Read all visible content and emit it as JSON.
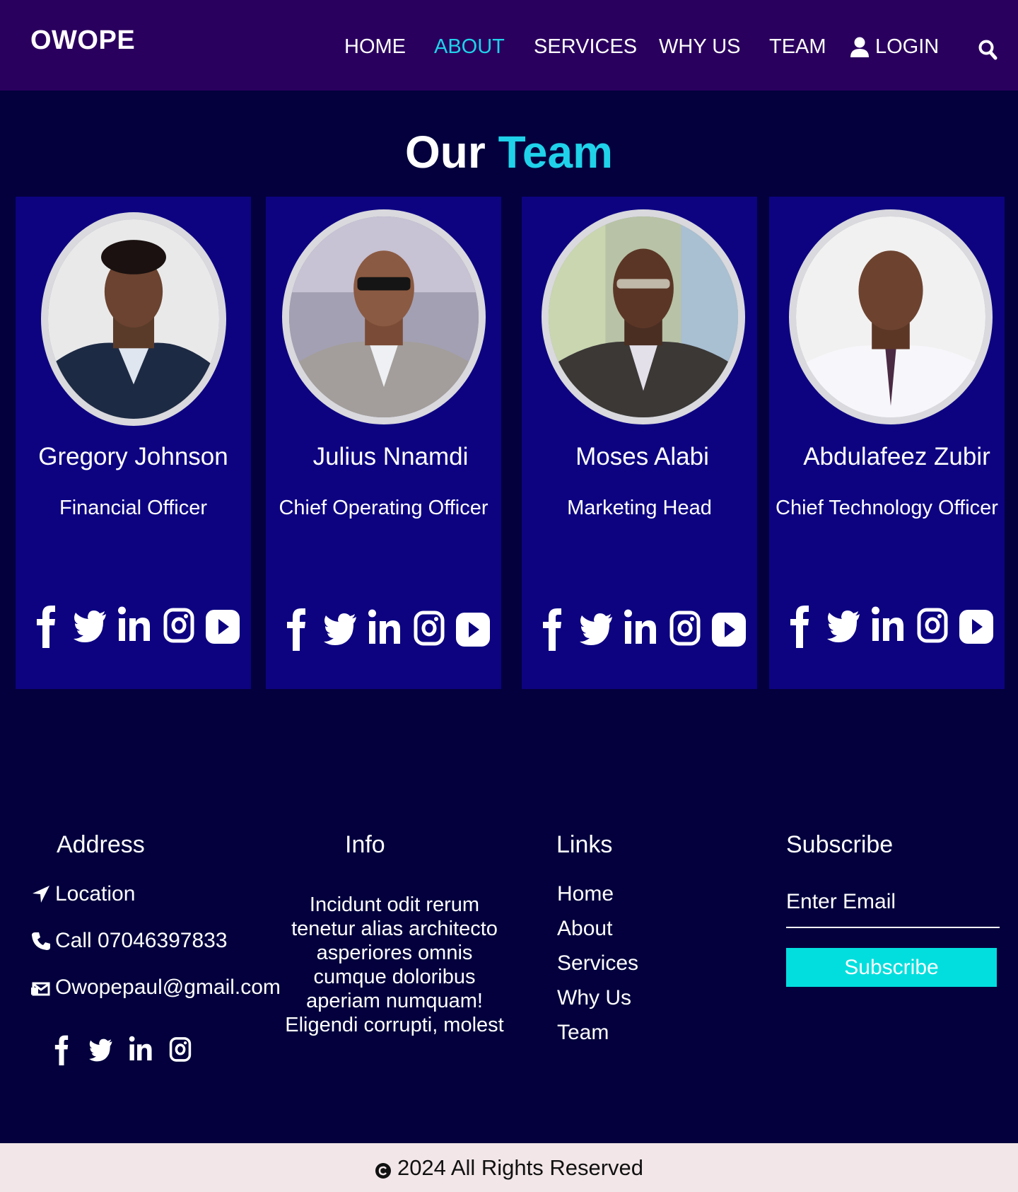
{
  "brand": {
    "logo": "OWOPE"
  },
  "nav": {
    "items": [
      {
        "label": "HOME",
        "active": false
      },
      {
        "label": "ABOUT",
        "active": true
      },
      {
        "label": "SERVICES",
        "active": false
      },
      {
        "label": "WHY US",
        "active": false
      },
      {
        "label": "TEAM",
        "active": false
      }
    ],
    "login_label": "LOGIN",
    "accent_color": "#1fd2ea"
  },
  "team_section": {
    "title_prefix": "Our",
    "title_accent": "Team",
    "members": [
      {
        "name": "Gregory Johnson",
        "role": "Financial Officer"
      },
      {
        "name": "Julius Nnamdi",
        "role": "Chief Operating Officer"
      },
      {
        "name": "Moses Alabi",
        "role": "Marketing Head"
      },
      {
        "name": "Abdulafeez Zubir",
        "role": "Chief Technology Officer"
      }
    ],
    "social_icons": [
      "facebook-icon",
      "twitter-icon",
      "linkedin-icon",
      "instagram-icon",
      "youtube-icon"
    ]
  },
  "footer": {
    "address": {
      "title": "Address",
      "location": "Location",
      "phone": "Call 07046397833",
      "email": "Owopepaul@gmail.com",
      "social_icons": [
        "facebook-icon",
        "twitter-icon",
        "linkedin-icon",
        "instagram-icon"
      ]
    },
    "info": {
      "title": "Info",
      "text": "Incidunt odit rerum tenetur alias architecto asperiores omnis cumque doloribus aperiam numquam! Eligendi corrupti, molest"
    },
    "links": {
      "title": "Links",
      "items": [
        "Home",
        "About",
        "Services",
        "Why Us",
        "Team"
      ]
    },
    "subscribe": {
      "title": "Subscribe",
      "placeholder": "Enter Email",
      "button_label": "Subscribe",
      "button_color": "#02dede"
    }
  },
  "copyright": {
    "text": "2024 All Rights Reserved"
  }
}
